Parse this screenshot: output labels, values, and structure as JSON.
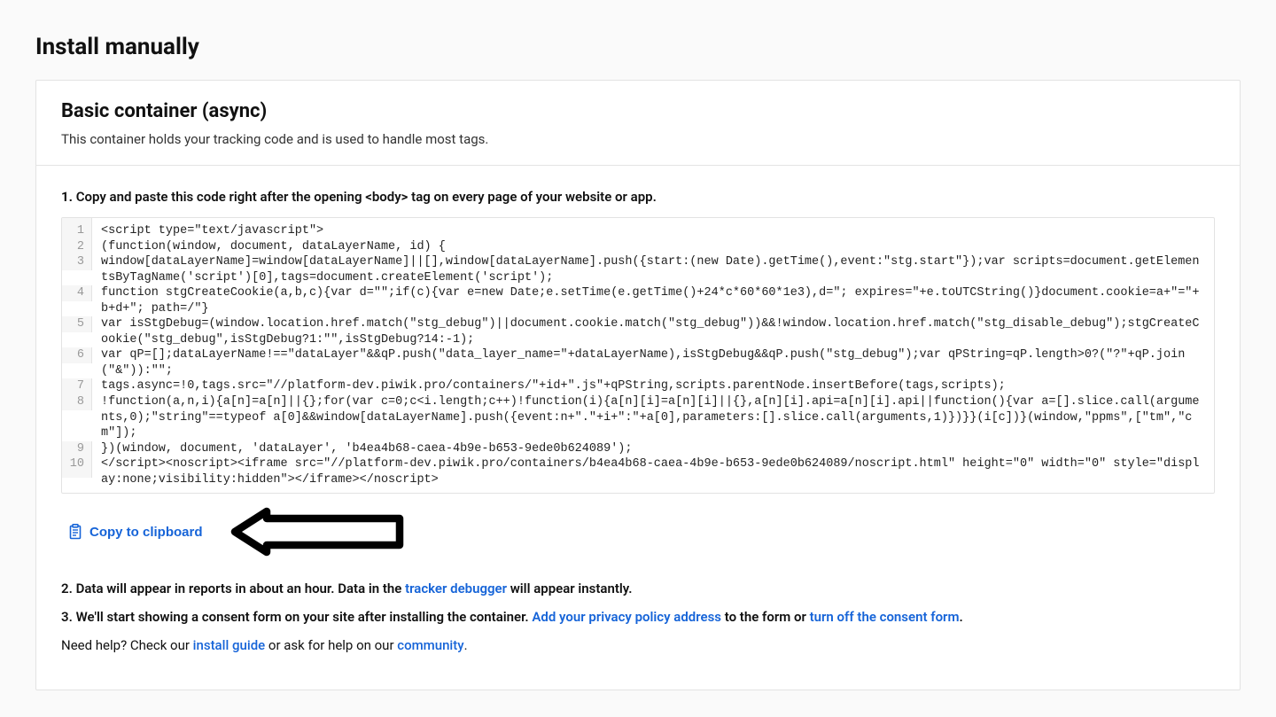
{
  "header": {
    "title": "Install manually"
  },
  "card": {
    "title": "Basic container (async)",
    "subtitle": "This container holds your tracking code and is used to handle most tags."
  },
  "step1": {
    "num": "1.",
    "text": "Copy and paste this code right after the opening <body> tag on every page of your website or app."
  },
  "code_lines": [
    {
      "n": "1",
      "t": "<script type=\"text/javascript\">"
    },
    {
      "n": "2",
      "t": "(function(window, document, dataLayerName, id) {"
    },
    {
      "n": "3",
      "t": "window[dataLayerName]=window[dataLayerName]||[],window[dataLayerName].push({start:(new Date).getTime(),event:\"stg.start\"});var scripts=document.getElementsByTagName('script')[0],tags=document.createElement('script');"
    },
    {
      "n": "4",
      "t": "function stgCreateCookie(a,b,c){var d=\"\";if(c){var e=new Date;e.setTime(e.getTime()+24*c*60*60*1e3),d=\"; expires=\"+e.toUTCString()}document.cookie=a+\"=\"+b+d+\"; path=/\"}"
    },
    {
      "n": "5",
      "t": "var isStgDebug=(window.location.href.match(\"stg_debug\")||document.cookie.match(\"stg_debug\"))&&!window.location.href.match(\"stg_disable_debug\");stgCreateCookie(\"stg_debug\",isStgDebug?1:\"\",isStgDebug?14:-1);"
    },
    {
      "n": "6",
      "t": "var qP=[];dataLayerName!==\"dataLayer\"&&qP.push(\"data_layer_name=\"+dataLayerName),isStgDebug&&qP.push(\"stg_debug\");var qPString=qP.length>0?(\"?\"+qP.join(\"&\")):\"\";"
    },
    {
      "n": "7",
      "t": "tags.async=!0,tags.src=\"//platform-dev.piwik.pro/containers/\"+id+\".js\"+qPString,scripts.parentNode.insertBefore(tags,scripts);"
    },
    {
      "n": "8",
      "t": "!function(a,n,i){a[n]=a[n]||{};for(var c=0;c<i.length;c++)!function(i){a[n][i]=a[n][i]||{},a[n][i].api=a[n][i].api||function(){var a=[].slice.call(arguments,0);\"string\"==typeof a[0]&&window[dataLayerName].push({event:n+\".\"+i+\":\"+a[0],parameters:[].slice.call(arguments,1)})}}(i[c])}(window,\"ppms\",[\"tm\",\"cm\"]);"
    },
    {
      "n": "9",
      "t": "})(window, document, 'dataLayer', 'b4ea4b68-caea-4b9e-b653-9ede0b624089');"
    },
    {
      "n": "10",
      "t": "</script><noscript><iframe src=\"//platform-dev.piwik.pro/containers/b4ea4b68-caea-4b9e-b653-9ede0b624089/noscript.html\" height=\"0\" width=\"0\" style=\"display:none;visibility:hidden\"></iframe></noscript>"
    }
  ],
  "copy": {
    "label": "Copy to clipboard"
  },
  "step2": {
    "num": "2.",
    "prefix": "Data will appear in reports in about an hour. Data in the ",
    "link": "tracker debugger",
    "suffix": " will appear instantly."
  },
  "step3": {
    "num": "3.",
    "prefix": "We'll start showing a consent form on your site after installing the container. ",
    "link1": "Add your privacy policy address",
    "mid": " to the form or ",
    "link2": "turn off the consent form",
    "suffix": "."
  },
  "help": {
    "prefix": "Need help? Check our ",
    "link1": "install guide",
    "mid": " or ask for help on our ",
    "link2": "community",
    "suffix": "."
  }
}
